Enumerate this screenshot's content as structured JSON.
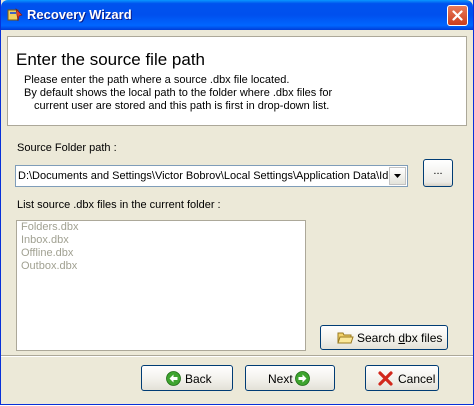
{
  "window": {
    "title": "Recovery Wizard",
    "close_icon": "close-icon"
  },
  "header": {
    "title": "Enter the source file path",
    "desc_line1": "Please enter the path where a source .dbx file located.",
    "desc_line2": "By default shows the local path to the folder where .dbx files for",
    "desc_line3": "current  user are stored and this path is first in drop-down list."
  },
  "source": {
    "label": "Source Folder path :",
    "value": "D:\\Documents and Settings\\Victor Bobrov\\Local Settings\\Application Data\\Identities\\{",
    "browse_label": "..."
  },
  "files": {
    "label": "List source .dbx files in the current folder :",
    "items": [
      "Folders.dbx",
      "Inbox.dbx",
      "Offline.dbx",
      "Outbox.dbx"
    ]
  },
  "search": {
    "label_pre": "Search ",
    "label_ul": "d",
    "label_post": "bx files",
    "icon": "folder-open-icon"
  },
  "footer": {
    "back_label": "Back",
    "next_label": "Next",
    "cancel_label": "Cancel",
    "back_icon": "arrow-left-icon",
    "next_icon": "arrow-right-icon",
    "cancel_icon": "red-x-icon"
  },
  "colors": {
    "titlebar": "#0053ee",
    "face": "#ece9d8",
    "disabled_text": "#a1a192",
    "back_next_icon": "#3ea42f",
    "cancel_icon": "#d2281c"
  }
}
